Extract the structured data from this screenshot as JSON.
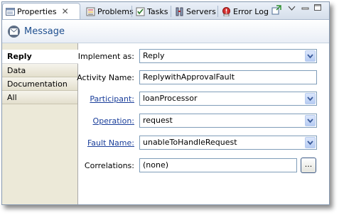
{
  "tabs": [
    {
      "label": "Properties",
      "icon": "properties-icon"
    },
    {
      "label": "Problems",
      "icon": "problems-icon"
    },
    {
      "label": "Tasks",
      "icon": "tasks-icon"
    },
    {
      "label": "Servers",
      "icon": "servers-icon"
    },
    {
      "label": "Error Log",
      "icon": "error-log-icon"
    }
  ],
  "header": {
    "title": "Message",
    "icon": "message-icon"
  },
  "nav": [
    "Reply",
    "Data",
    "Documentation",
    "All"
  ],
  "form": {
    "implement_as": {
      "label": "Implement as:",
      "value": "Reply"
    },
    "activity_name": {
      "label": "Activity Name:",
      "value": "ReplywithApprovalFault"
    },
    "participant": {
      "label": "Participant:",
      "value": "loanProcessor"
    },
    "operation": {
      "label": "Operation:",
      "value": "request"
    },
    "fault_name": {
      "label": "Fault Name:",
      "value": "unableToHandleRequest"
    },
    "correlations": {
      "label": "Correlations:",
      "value": "(none)",
      "button": "..."
    }
  },
  "colors": {
    "accent": "#1f4f8f",
    "link": "#1a3e9a",
    "field_border": "#7f9db9"
  }
}
